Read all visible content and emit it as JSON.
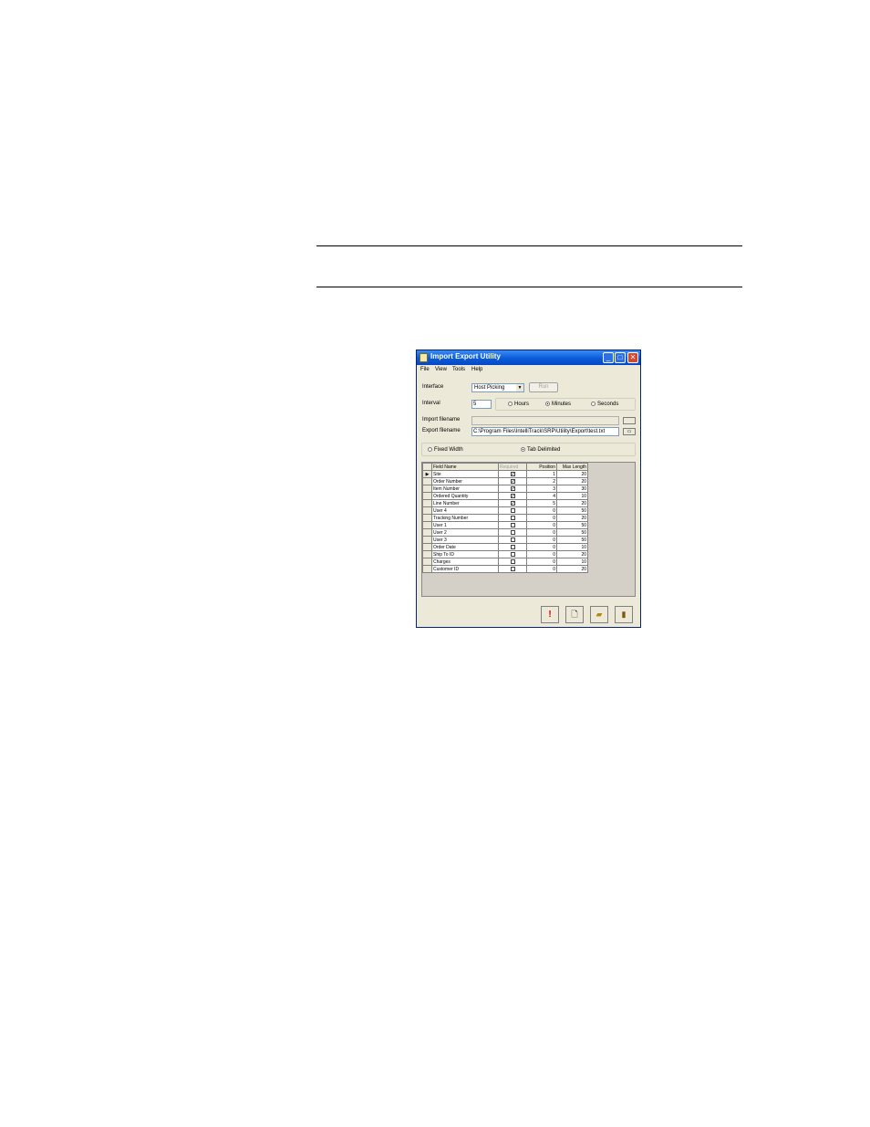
{
  "window": {
    "title": "Import Export Utility"
  },
  "menu": [
    "File",
    "View",
    "Tools",
    "Help"
  ],
  "interface": {
    "label": "Interface",
    "value": "Host Picking",
    "button": "Run"
  },
  "interval": {
    "label": "Interval",
    "value": "5",
    "options": [
      "Hours",
      "Minutes",
      "Seconds"
    ],
    "selected": "Minutes"
  },
  "import_filename": {
    "label": "Import filename",
    "value": ""
  },
  "export_filename": {
    "label": "Export filename",
    "value": "C:\\Program Files\\IntelliTrack\\SRP\\Utility\\Export\\test.txt"
  },
  "format": {
    "options": [
      "Fixed Width",
      "Tab Delimited"
    ],
    "selected": "Tab Delimited"
  },
  "table": {
    "headers": [
      "Field Name",
      "Required",
      "Position",
      "Max Length"
    ],
    "rows": [
      {
        "name": "Site",
        "required": true,
        "position": "1",
        "max": "20"
      },
      {
        "name": "Order Number",
        "required": true,
        "position": "2",
        "max": "20"
      },
      {
        "name": "Item Number",
        "required": true,
        "position": "3",
        "max": "30"
      },
      {
        "name": "Ordered Quantity",
        "required": true,
        "position": "4",
        "max": "10"
      },
      {
        "name": "Line Number",
        "required": true,
        "position": "5",
        "max": "20"
      },
      {
        "name": "User 4",
        "required": false,
        "position": "0",
        "max": "50"
      },
      {
        "name": "Tracking Number",
        "required": false,
        "position": "0",
        "max": "20"
      },
      {
        "name": "User 1",
        "required": false,
        "position": "0",
        "max": "50"
      },
      {
        "name": "User 2",
        "required": false,
        "position": "0",
        "max": "50"
      },
      {
        "name": "User 3",
        "required": false,
        "position": "0",
        "max": "50"
      },
      {
        "name": "Order Date",
        "required": false,
        "position": "0",
        "max": "10"
      },
      {
        "name": "Ship To ID",
        "required": false,
        "position": "0",
        "max": "20"
      },
      {
        "name": "Charges",
        "required": false,
        "position": "0",
        "max": "10"
      },
      {
        "name": "Customer ID",
        "required": false,
        "position": "0",
        "max": "20"
      }
    ]
  },
  "toolbar": {
    "icons": [
      "exclamation-icon",
      "print-preview-icon",
      "open-folder-icon",
      "exit-door-icon"
    ],
    "colors": {
      "exclamation": "#cc0000",
      "folder": "#e0c040",
      "door": "#7a5a10"
    }
  }
}
